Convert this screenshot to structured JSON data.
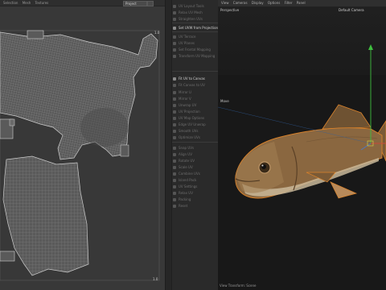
{
  "uv_editor": {
    "menu": [
      "Selection",
      "Mesh",
      "Textures"
    ],
    "dropdown_value": "Project",
    "tick_top": "1.0",
    "tick_bottom": "1.0"
  },
  "tools": {
    "items": [
      {
        "label": "UV Layout Tools",
        "active": false
      },
      {
        "label": "Relax UV Mesh",
        "active": false
      },
      {
        "label": "Straighten UVs",
        "active": false
      },
      {
        "label": "Set UVW from Projection",
        "active": true
      },
      {
        "label": "UV Terrace",
        "active": false
      },
      {
        "label": "UV Planes",
        "active": false
      },
      {
        "label": "Set Frontal Mapping",
        "active": false
      },
      {
        "label": "Transform UV Mapping",
        "active": false
      },
      {
        "label": "Fit UV to Canvas",
        "active": true
      },
      {
        "label": "Fit Canvas to UV",
        "active": false
      },
      {
        "label": "Mirror U",
        "active": false
      },
      {
        "label": "Mirror V",
        "active": false
      },
      {
        "label": "Unwrap UV",
        "active": false
      },
      {
        "label": "UV Projection",
        "active": false
      },
      {
        "label": "UV Map Options",
        "active": false
      },
      {
        "label": "Edge UV Unwrap",
        "active": false
      },
      {
        "label": "Smooth UVs",
        "active": false
      },
      {
        "label": "Optimize UVs",
        "active": false
      },
      {
        "label": "Snap UVs",
        "active": false
      },
      {
        "label": "Align UV",
        "active": false
      },
      {
        "label": "Rotate UV",
        "active": false
      },
      {
        "label": "Scale UV",
        "active": false
      },
      {
        "label": "Combine UVs",
        "active": false
      },
      {
        "label": "Island Pack",
        "active": false
      },
      {
        "label": "UV Settings",
        "active": false
      },
      {
        "label": "Relax UV",
        "active": false
      },
      {
        "label": "Packing",
        "active": false
      },
      {
        "label": "Reset",
        "active": false
      }
    ]
  },
  "viewport": {
    "menu": [
      "View",
      "Cameras",
      "Display",
      "Options",
      "Filter",
      "Panel"
    ],
    "label": "Perspective",
    "camera": "Default Camera",
    "tool_label": "Move",
    "footer": "View Transform: Scene"
  },
  "colors": {
    "background": "#2b2b2b",
    "uv_panel": "#383838",
    "uv_mesh_fill": "#595959",
    "viewport_bg": "#1d1d1d",
    "fish_body": "#8a6740",
    "selection_outline": "#d9822b",
    "axis_green": "#3fbf3f",
    "axis_red": "#c84a3a",
    "axis_blue": "#4a78c8"
  }
}
